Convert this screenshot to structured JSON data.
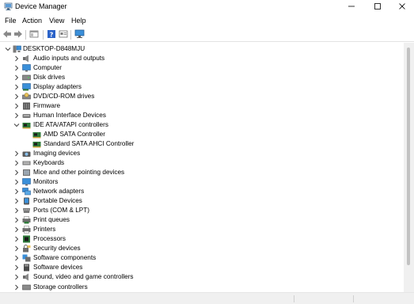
{
  "window": {
    "title": "Device Manager",
    "app_icon": "device-manager-icon",
    "controls": [
      "minimize-icon",
      "maximize-icon",
      "close-icon"
    ]
  },
  "menu": [
    {
      "label": "File"
    },
    {
      "label": "Action"
    },
    {
      "label": "View"
    },
    {
      "label": "Help"
    }
  ],
  "toolbar": {
    "buttons": [
      "back-arrow-icon",
      "forward-arrow-icon",
      "properties-pane-icon",
      "help-icon",
      "properties-icon",
      "monitor-icon"
    ]
  },
  "tree": {
    "root": {
      "label": "DESKTOP-D848MJU",
      "icon": "computer-icon",
      "expanded": true
    },
    "items": [
      {
        "label": "Audio inputs and outputs",
        "icon": "speaker-icon",
        "expanded": false
      },
      {
        "label": "Computer",
        "icon": "computer-monitor-icon",
        "expanded": false
      },
      {
        "label": "Disk drives",
        "icon": "disk-drive-icon",
        "expanded": false
      },
      {
        "label": "Display adapters",
        "icon": "display-adapter-icon",
        "expanded": false
      },
      {
        "label": "DVD/CD-ROM drives",
        "icon": "dvd-drive-icon",
        "expanded": false
      },
      {
        "label": "Firmware",
        "icon": "firmware-icon",
        "expanded": false
      },
      {
        "label": "Human Interface Devices",
        "icon": "hid-icon",
        "expanded": false
      },
      {
        "label": "IDE ATA/ATAPI controllers",
        "icon": "ide-controller-icon",
        "expanded": true,
        "children": [
          {
            "label": "AMD SATA Controller",
            "icon": "ide-controller-icon"
          },
          {
            "label": "Standard SATA AHCI Controller",
            "icon": "ide-controller-icon"
          }
        ]
      },
      {
        "label": "Imaging devices",
        "icon": "camera-icon",
        "expanded": false
      },
      {
        "label": "Keyboards",
        "icon": "keyboard-icon",
        "expanded": false
      },
      {
        "label": "Mice and other pointing devices",
        "icon": "mouse-icon",
        "expanded": false
      },
      {
        "label": "Monitors",
        "icon": "monitor-icon",
        "expanded": false
      },
      {
        "label": "Network adapters",
        "icon": "network-adapter-icon",
        "expanded": false
      },
      {
        "label": "Portable Devices",
        "icon": "portable-device-icon",
        "expanded": false
      },
      {
        "label": "Ports (COM & LPT)",
        "icon": "port-icon",
        "expanded": false
      },
      {
        "label": "Print queues",
        "icon": "print-queue-icon",
        "expanded": false
      },
      {
        "label": "Printers",
        "icon": "printer-icon",
        "expanded": false
      },
      {
        "label": "Processors",
        "icon": "processor-icon",
        "expanded": false
      },
      {
        "label": "Security devices",
        "icon": "security-device-icon",
        "expanded": false
      },
      {
        "label": "Software components",
        "icon": "software-component-icon",
        "expanded": false
      },
      {
        "label": "Software devices",
        "icon": "software-device-icon",
        "expanded": false
      },
      {
        "label": "Sound, video and game controllers",
        "icon": "sound-controller-icon",
        "expanded": false
      },
      {
        "label": "Storage controllers",
        "icon": "storage-controller-icon",
        "expanded": false
      }
    ]
  },
  "colors": {
    "accent_blue": "#2b77d1",
    "monitor_blue": "#3a8fd9",
    "chip_green": "#2f7a3a",
    "scroll_track": "#f0f0f0",
    "scroll_thumb": "#c2c2c2"
  }
}
